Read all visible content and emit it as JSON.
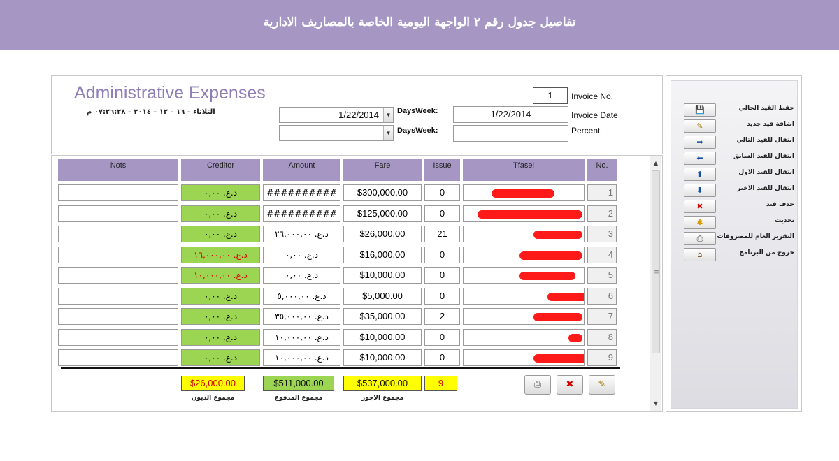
{
  "window": {
    "title": "تفاصيل جدول رقم ٢ الواجهة اليومية الخاصة بالمصاريف الادارية"
  },
  "form": {
    "app_title": "Administrative Expenses",
    "date_line": "الثلاثاء – ١٦ – ١٢ – ٢٠١٤ – ٠٧:٢٦:٢٨ م",
    "invoice_no_label": "Invoice No.",
    "invoice_no": "1",
    "invoice_date_label": "Invoice Date",
    "invoice_date": "1/22/2014",
    "percent_label": "Percent",
    "percent": "",
    "daysweek1_label": "DaysWeek:",
    "daysweek1": "1/22/2014",
    "daysweek2_label": "DaysWeek:",
    "daysweek2": ""
  },
  "grid": {
    "headers": {
      "nots": "Nots",
      "creditor": "Creditor",
      "amount": "Amount",
      "fare": "Fare",
      "issue": "Issue",
      "tfasel": "Tfasel",
      "no": "No."
    },
    "rows": [
      {
        "no": "1",
        "nots": "",
        "creditor": "د.ع. ٠,٠٠",
        "creditor_red": false,
        "amount": "##########",
        "fare": "$300,000.00",
        "issue": "0",
        "tfasel": ""
      },
      {
        "no": "2",
        "nots": "",
        "creditor": "د.ع. ٠,٠٠",
        "creditor_red": false,
        "amount": "##########",
        "fare": "$125,000.00",
        "issue": "0",
        "tfasel": ""
      },
      {
        "no": "3",
        "nots": "",
        "creditor": "د.ع. ٠,٠٠",
        "creditor_red": false,
        "amount": "د.ع. ٢٦,٠٠٠,٠٠",
        "fare": "$26,000.00",
        "issue": "21",
        "tfasel": ""
      },
      {
        "no": "4",
        "nots": "",
        "creditor": "د.ع. ١٦,٠٠٠,٠٠",
        "creditor_red": true,
        "amount": "د.ع. ٠,٠٠",
        "fare": "$16,000.00",
        "issue": "0",
        "tfasel": ""
      },
      {
        "no": "5",
        "nots": "",
        "creditor": "د.ع. ١٠,٠٠٠,٠٠",
        "creditor_red": true,
        "amount": "د.ع. ٠,٠٠",
        "fare": "$10,000.00",
        "issue": "0",
        "tfasel": ""
      },
      {
        "no": "6",
        "nots": "",
        "creditor": "د.ع. ٠,٠٠",
        "creditor_red": false,
        "amount": "د.ع. ٥,٠٠٠,٠٠",
        "fare": "$5,000.00",
        "issue": "0",
        "tfasel": ""
      },
      {
        "no": "7",
        "nots": "",
        "creditor": "د.ع. ٠,٠٠",
        "creditor_red": false,
        "amount": "د.ع. ٣٥,٠٠٠,٠٠",
        "fare": "$35,000.00",
        "issue": "2",
        "tfasel": ""
      },
      {
        "no": "8",
        "nots": "",
        "creditor": "د.ع. ٠,٠٠",
        "creditor_red": false,
        "amount": "د.ع. ١٠,٠٠٠,٠٠",
        "fare": "$10,000.00",
        "issue": "0",
        "tfasel": ""
      },
      {
        "no": "9",
        "nots": "",
        "creditor": "د.ع. ٠,٠٠",
        "creditor_red": false,
        "amount": "د.ع. ١٠,٠٠٠,٠٠",
        "fare": "$10,000.00",
        "issue": "0",
        "tfasel": ""
      }
    ]
  },
  "totals": {
    "debts": "$26,000.00",
    "debts_label": "مجموع الديون",
    "paid": "$511,000.00",
    "paid_label": "مجموع المدفوع",
    "fares": "$537,000.00",
    "fares_label": "مجموع الاجور",
    "issue_total": "9"
  },
  "sidebar": {
    "items": [
      {
        "label": "حفظ القيد الحالي",
        "icon": "save-icon"
      },
      {
        "label": "اضافة قيد جديد",
        "icon": "edit-new-icon"
      },
      {
        "label": "انتقال للقيد التالي",
        "icon": "arrow-right-icon"
      },
      {
        "label": "انتقال للقيد السابق",
        "icon": "arrow-left-icon"
      },
      {
        "label": "انتقال للقيد الاول",
        "icon": "arrow-up-icon"
      },
      {
        "label": "انتقال للقيد الاخير",
        "icon": "arrow-down-icon"
      },
      {
        "label": "حذف قيد",
        "icon": "delete-record-icon"
      },
      {
        "label": "تحديث",
        "icon": "refresh-icon"
      },
      {
        "label": "التقرير العام للمصروفات",
        "icon": "print-icon"
      },
      {
        "label": "خروج من البرنامج",
        "icon": "home-icon"
      }
    ]
  },
  "colors": {
    "header": "#a596c4",
    "green_cell": "#9bd552",
    "yellow_total": "#ffff00",
    "accent_text": "#8e7fb6"
  }
}
